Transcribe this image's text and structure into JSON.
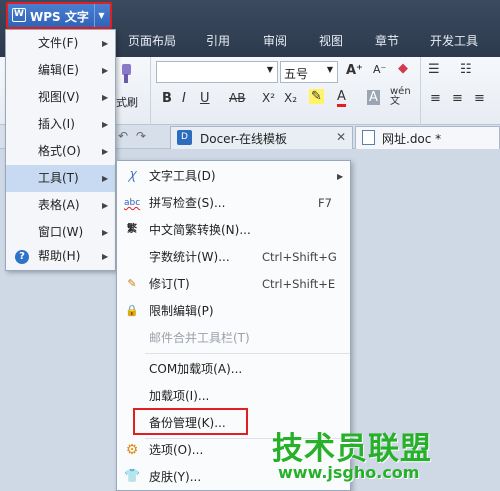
{
  "app": {
    "button_label": "WPS 文字",
    "w_glyph": "W"
  },
  "ribbon_tabs": [
    "页面布局",
    "引用",
    "审阅",
    "视图",
    "章节",
    "开发工具"
  ],
  "ribbon": {
    "font_size": "五号",
    "format_painter_label": "式刷",
    "bold": "B",
    "italic": "I",
    "underline": "U",
    "strike": "AB",
    "superscript": "X²",
    "subscript": "X₂",
    "font_color": "A",
    "grow_font": "A⁺",
    "shrink_font": "A⁻"
  },
  "doc_tabs": [
    {
      "label": "Docer-在线模板"
    },
    {
      "label": "网址.doc *"
    }
  ],
  "main_menu": [
    {
      "label": "文件(F)",
      "has_submenu": true
    },
    {
      "label": "编辑(E)",
      "has_submenu": true
    },
    {
      "label": "视图(V)",
      "has_submenu": true
    },
    {
      "label": "插入(I)",
      "has_submenu": true
    },
    {
      "label": "格式(O)",
      "has_submenu": true
    },
    {
      "label": "工具(T)",
      "has_submenu": true,
      "active": true
    },
    {
      "label": "表格(A)",
      "has_submenu": true
    },
    {
      "label": "窗口(W)",
      "has_submenu": true
    },
    {
      "label": "帮助(H)",
      "has_submenu": true
    }
  ],
  "tools_menu": [
    {
      "label": "文字工具(D)",
      "shortcut": "",
      "icon": "text-tool-icon",
      "has_submenu": true
    },
    {
      "label": "拼写检查(S)...",
      "shortcut": "F7",
      "icon": "spellcheck-icon"
    },
    {
      "label": "中文简繁转换(N)...",
      "shortcut": "",
      "icon": "chinese-convert-icon"
    },
    {
      "label": "字数统计(W)...",
      "shortcut": "Ctrl+Shift+G",
      "icon": ""
    },
    {
      "label": "修订(T)",
      "shortcut": "Ctrl+Shift+E",
      "icon": "revise-icon"
    },
    {
      "label": "限制编辑(P)",
      "shortcut": "",
      "icon": "lock-icon"
    },
    {
      "label": "邮件合并工具栏(T)",
      "shortcut": "",
      "icon": "",
      "disabled": true
    },
    {
      "label": "COM加载项(A)...",
      "shortcut": "",
      "icon": ""
    },
    {
      "label": "加载项(I)...",
      "shortcut": "",
      "icon": ""
    },
    {
      "label": "备份管理(K)...",
      "shortcut": "",
      "icon": ""
    },
    {
      "label": "选项(O)...",
      "shortcut": "",
      "icon": "gear-icon"
    },
    {
      "label": "皮肤(Y)...",
      "shortcut": "",
      "icon": "shirt-icon"
    }
  ],
  "watermark": {
    "text": "技术员联盟",
    "url": "www.jsgho.com"
  },
  "colors": {
    "highlight_red": "#e02020",
    "menu_active": "#c7daf1",
    "watermark_green": "#27b02a"
  }
}
